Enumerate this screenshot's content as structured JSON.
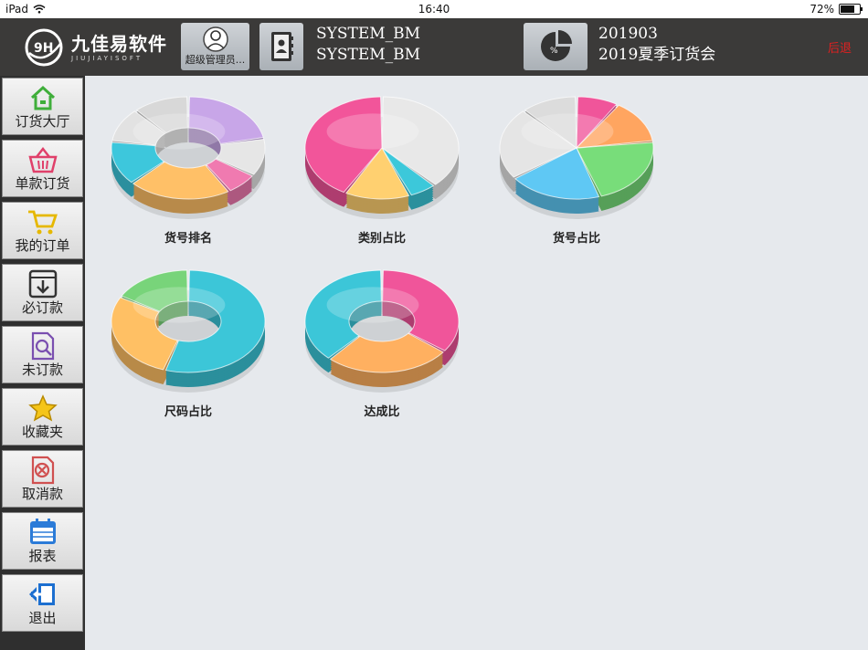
{
  "status_bar": {
    "device": "iPad",
    "time": "16:40",
    "battery": "72%"
  },
  "header": {
    "logo_text": "九佳易软件",
    "logo_sub": "JIUJIAYISOFT",
    "user_label": "超级管理员...",
    "user_line1": "SYSTEM_BM",
    "user_line2": "SYSTEM_BM",
    "period_code": "201903",
    "event_name": "2019夏季订货会",
    "logout_label": "后退"
  },
  "sidebar": {
    "items": [
      {
        "label": "订货大厅",
        "icon": "home-icon"
      },
      {
        "label": "单款订货",
        "icon": "basket-icon"
      },
      {
        "label": "我的订单",
        "icon": "cart-icon"
      },
      {
        "label": "必订款",
        "icon": "download-box-icon"
      },
      {
        "label": "未订款",
        "icon": "search-document-icon"
      },
      {
        "label": "收藏夹",
        "icon": "star-icon"
      },
      {
        "label": "取消款",
        "icon": "cancel-document-icon"
      },
      {
        "label": "报表",
        "icon": "calendar-icon"
      },
      {
        "label": "退出",
        "icon": "exit-icon"
      }
    ]
  },
  "reports": [
    {
      "label": "货号排名",
      "style": "donut",
      "slices": [
        22,
        12,
        7,
        22,
        14,
        11,
        12
      ],
      "colors": [
        "#c8a6e8",
        "#e6e6e6",
        "#f07ab0",
        "#ffc067",
        "#3dc7dc",
        "#e2e2e2",
        "#d8d8d8"
      ]
    },
    {
      "label": "类别占比",
      "style": "pie",
      "slices": [
        38,
        6,
        14,
        42
      ],
      "colors": [
        "#e8e8e8",
        "#3cc8da",
        "#ffd070",
        "#f2559a"
      ]
    },
    {
      "label": "货号占比",
      "style": "pie",
      "slices": [
        9,
        14,
        22,
        20,
        23,
        12
      ],
      "colors": [
        "#f0559a",
        "#ffa560",
        "#78dd7a",
        "#5fc8f4",
        "#e5e5e5",
        "#dcdcdc"
      ]
    },
    {
      "label": "尺码占比",
      "style": "donut",
      "slices": [
        55,
        28,
        17
      ],
      "colors": [
        "#3cc6d8",
        "#ffc064",
        "#78d47a"
      ]
    },
    {
      "label": "达成比",
      "style": "donut",
      "slices": [
        35,
        27,
        38
      ],
      "colors": [
        "#f0559a",
        "#ffb060",
        "#3cc6d8"
      ]
    }
  ]
}
